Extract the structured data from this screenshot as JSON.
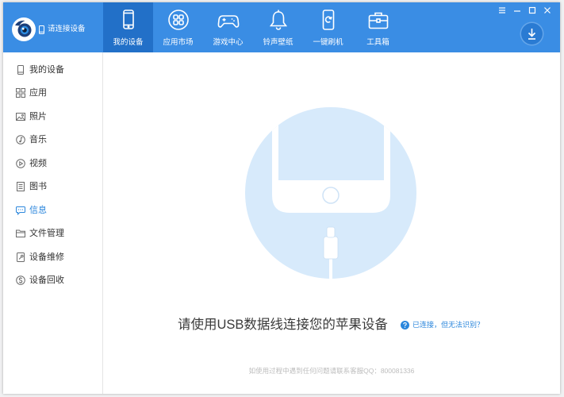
{
  "app": {
    "logo_icon": "itools-logo-icon",
    "device_status_icon": "phone-small-icon",
    "device_status": "请连接设备"
  },
  "colors": {
    "header_bg": "#3a8de4",
    "active_tab_bg": "#2270c8",
    "download_button": "#2a7bd3",
    "link": "#2a86dc",
    "illustration_bg": "#d7eafb",
    "text": "#3a3a3a",
    "footer_text": "#bdbdbd"
  },
  "header": {
    "tabs": [
      {
        "label": "我的设备",
        "icon": "device-icon",
        "active": true
      },
      {
        "label": "应用市场",
        "icon": "app-store-icon",
        "active": false
      },
      {
        "label": "游戏中心",
        "icon": "gamepad-icon",
        "active": false
      },
      {
        "label": "铃声壁纸",
        "icon": "bell-icon",
        "active": false
      },
      {
        "label": "一键刷机",
        "icon": "flash-device-icon",
        "active": false
      },
      {
        "label": "工具箱",
        "icon": "toolbox-icon",
        "active": false
      }
    ],
    "window_controls": [
      "menu-icon",
      "minimize-icon",
      "maximize-icon",
      "close-icon"
    ],
    "download_icon": "download-icon"
  },
  "sidebar": {
    "items": [
      {
        "label": "我的设备",
        "icon": "device-outline-icon",
        "highlighted": false
      },
      {
        "label": "应用",
        "icon": "apps-grid-icon",
        "highlighted": false
      },
      {
        "label": "照片",
        "icon": "photo-icon",
        "highlighted": false
      },
      {
        "label": "音乐",
        "icon": "music-icon",
        "highlighted": false
      },
      {
        "label": "视频",
        "icon": "video-icon",
        "highlighted": false
      },
      {
        "label": "图书",
        "icon": "book-icon",
        "highlighted": false
      },
      {
        "label": "信息",
        "icon": "message-icon",
        "highlighted": true
      },
      {
        "label": "文件管理",
        "icon": "folder-icon",
        "highlighted": false
      },
      {
        "label": "设备维修",
        "icon": "repair-icon",
        "highlighted": false
      },
      {
        "label": "设备回收",
        "icon": "recycle-coin-icon",
        "highlighted": false
      }
    ]
  },
  "main": {
    "illustration_icon": "phone-with-lightning-cable-illustration",
    "connect_prompt": "请使用USB数据线连接您的苹果设备",
    "help_icon": "question-circle-icon",
    "help_link": "已连接，但无法识别？",
    "footer_note": "如使用过程中遇到任何问题请联系客服QQ：800081336"
  }
}
